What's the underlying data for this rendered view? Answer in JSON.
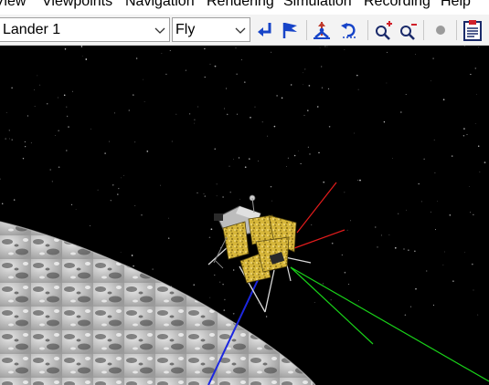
{
  "menu": {
    "items": [
      {
        "label": "View"
      },
      {
        "label": "Viewpoints"
      },
      {
        "label": "Navigation"
      },
      {
        "label": "Rendering"
      },
      {
        "label": "Simulation"
      },
      {
        "label": "Recording"
      },
      {
        "label": "Help"
      }
    ]
  },
  "toolbar": {
    "viewpoint_select": {
      "value": "Lander 1"
    },
    "navigation_mode_select": {
      "value": "Fly"
    },
    "buttons": [
      {
        "icon": "return-arrow-icon"
      },
      {
        "icon": "flag-icon"
      },
      {
        "icon": "figure-pole-icon"
      },
      {
        "icon": "rotate-back-icon"
      },
      {
        "icon": "zoom-in-icon"
      },
      {
        "icon": "zoom-out-icon"
      },
      {
        "icon": "record-dot-icon"
      },
      {
        "icon": "clipboard-icon"
      }
    ]
  },
  "scene": {
    "description_colors": {
      "axis_red": "#e31c1c",
      "axis_green": "#19d219",
      "axis_blue": "#1c27e0",
      "foil_gold": "#d7b73a"
    }
  }
}
